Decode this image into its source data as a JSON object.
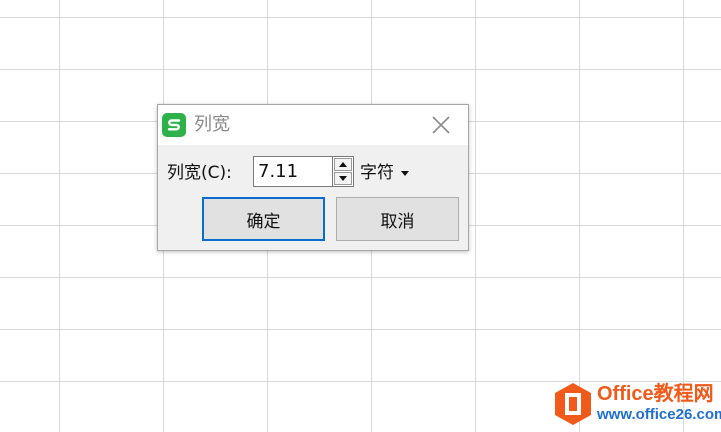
{
  "dialog": {
    "title": "列宽",
    "field_label": "列宽(C):",
    "width_value": "7.11",
    "unit_label": "字符",
    "ok_label": "确定",
    "cancel_label": "取消"
  },
  "icons": {
    "app": "wps-spreadsheet-icon",
    "close": "close-icon",
    "spin_up": "triangle-up-icon",
    "spin_down": "triangle-down-icon",
    "unit_dropdown": "caret-down-icon"
  },
  "watermark": {
    "name": "Office教程网",
    "url": "www.office26.com"
  },
  "colors": {
    "app_icon": "#2db24a",
    "focus_border": "#0a6cd0",
    "grid_line": "#d9d9d9",
    "logo_orange": "#f15a1a",
    "logo_blue": "#1f6fd0"
  }
}
